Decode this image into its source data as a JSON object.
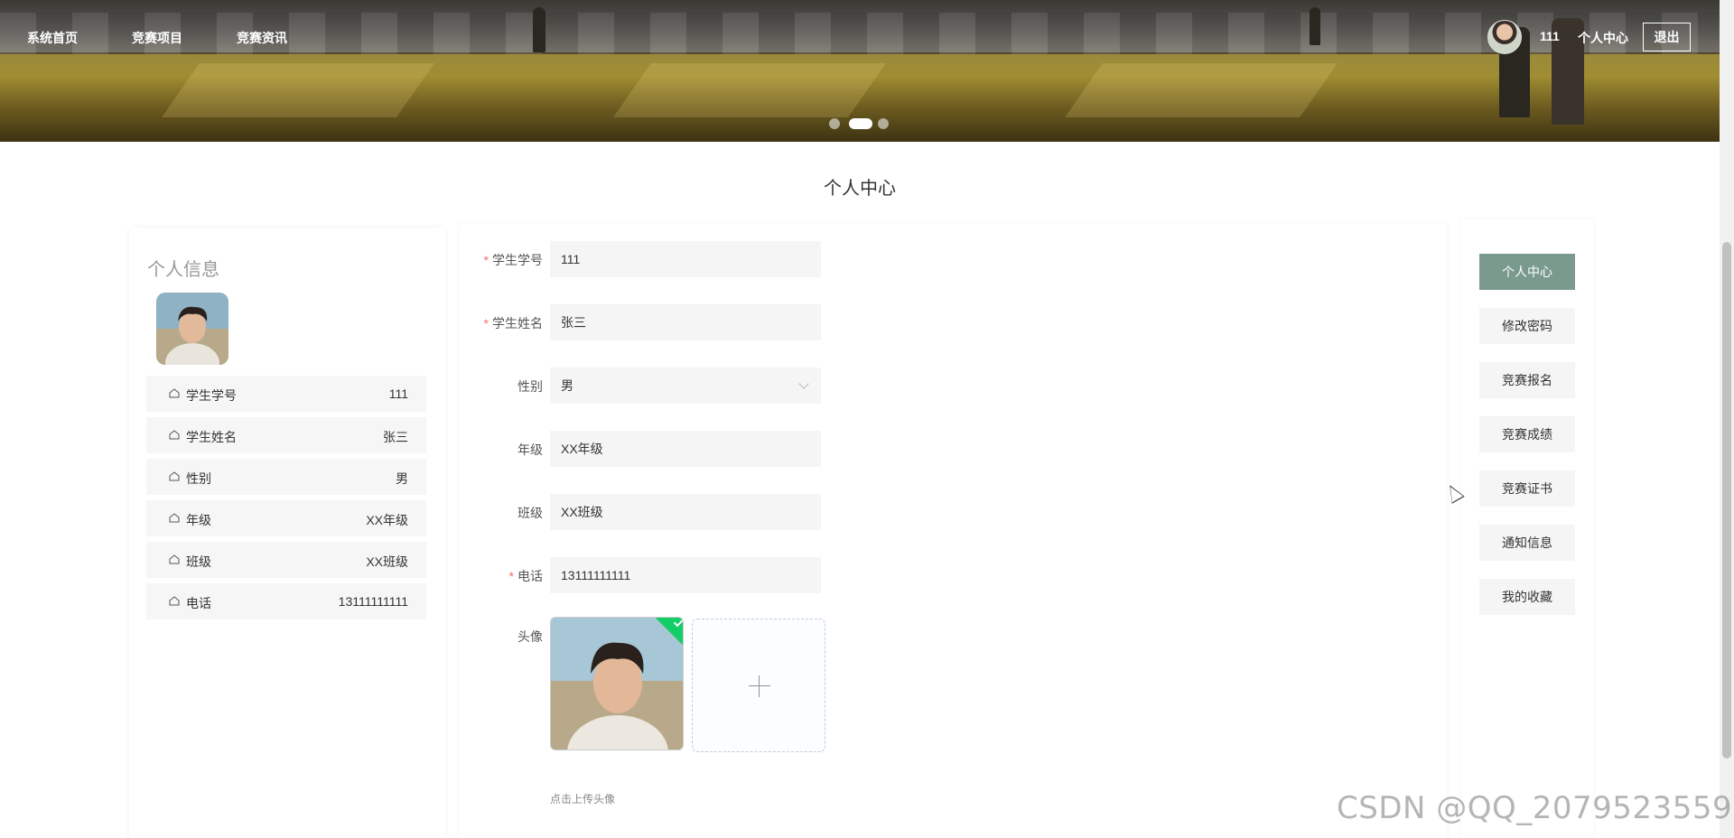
{
  "nav": {
    "links": [
      "系统首页",
      "竞赛项目",
      "竞赛资讯"
    ],
    "username": "111",
    "center_label": "个人中心",
    "logout_label": "退出"
  },
  "carousel": {
    "slides": 3,
    "active_index": 1
  },
  "page_title": "个人中心",
  "info_card": {
    "title": "个人信息",
    "rows": [
      {
        "label": "学生学号",
        "value": "111"
      },
      {
        "label": "学生姓名",
        "value": "张三"
      },
      {
        "label": "性别",
        "value": "男"
      },
      {
        "label": "年级",
        "value": "XX年级"
      },
      {
        "label": "班级",
        "value": "XX班级"
      },
      {
        "label": "电话",
        "value": "13111111111"
      }
    ]
  },
  "form": {
    "student_no": {
      "label": "学生学号",
      "value": "111",
      "required": true
    },
    "student_name": {
      "label": "学生姓名",
      "value": "张三",
      "required": true
    },
    "gender": {
      "label": "性别",
      "value": "男"
    },
    "grade": {
      "label": "年级",
      "value": "XX年级"
    },
    "class": {
      "label": "班级",
      "value": "XX班级"
    },
    "phone": {
      "label": "电话",
      "value": "13111111111",
      "required": true
    },
    "avatar": {
      "label": "头像",
      "tip": "点击上传头像"
    }
  },
  "menu": {
    "items": [
      "个人中心",
      "修改密码",
      "竞赛报名",
      "竞赛成绩",
      "竞赛证书",
      "通知信息",
      "我的收藏"
    ],
    "active_index": 0,
    "active_color": "#7a9a8e"
  },
  "watermark": "CSDN @QQ_2079523559",
  "icons": {
    "row_icon": "home-outline-icon",
    "upload_icon": "plus-icon",
    "success_icon": "check-icon"
  }
}
